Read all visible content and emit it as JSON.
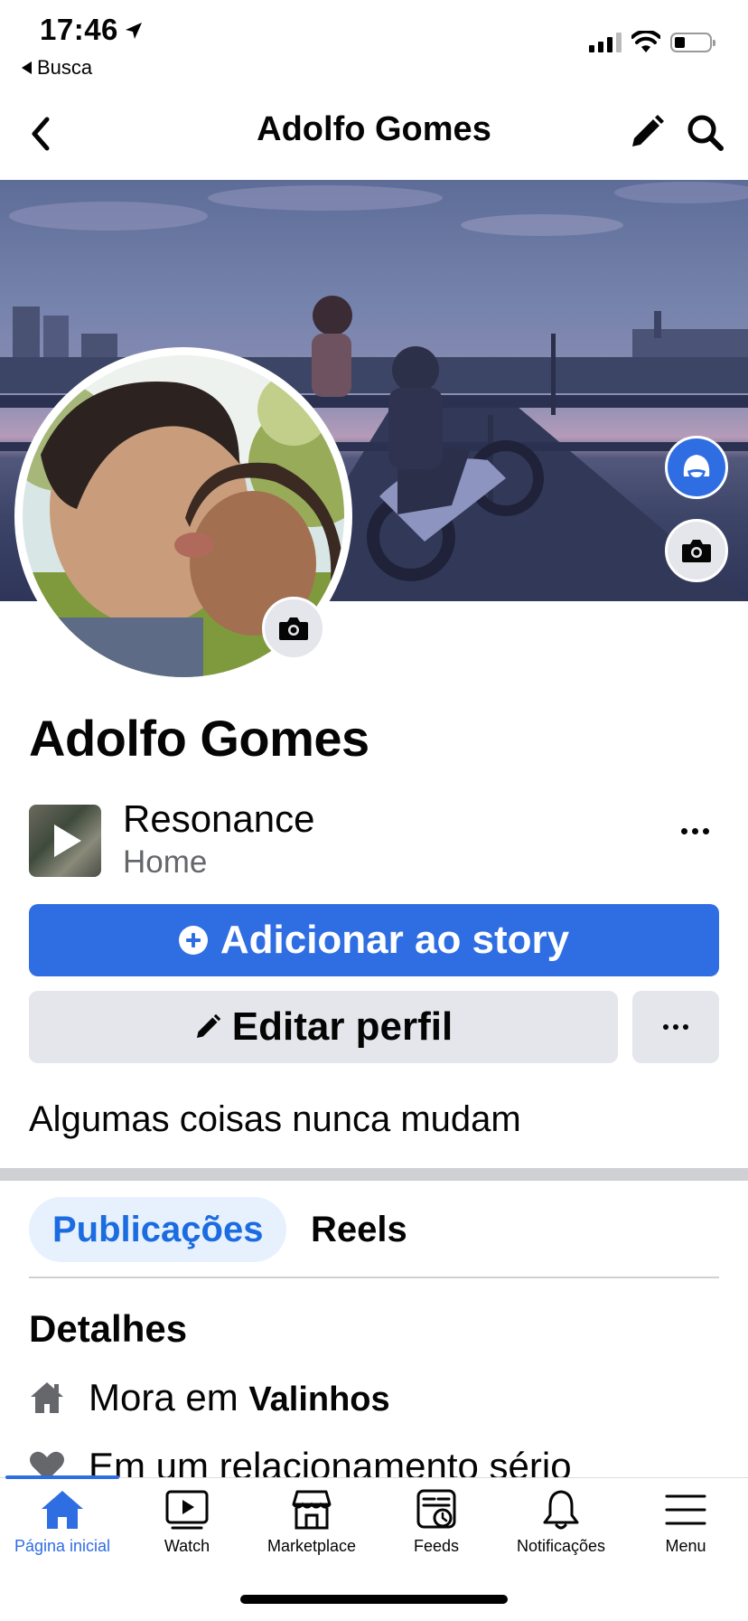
{
  "status_bar": {
    "time": "17:46",
    "back_app": "Busca",
    "location_icon": "location-arrow-icon",
    "signal_icon": "cellular-signal-icon",
    "wifi_icon": "wifi-icon",
    "battery_icon": "battery-icon"
  },
  "nav": {
    "title": "Adolfo Gomes",
    "back_icon": "chevron-left-icon",
    "edit_icon": "pencil-icon",
    "search_icon": "search-icon"
  },
  "profile": {
    "name": "Adolfo Gomes",
    "bio": "Algumas coisas nunca mudam"
  },
  "music": {
    "title": "Resonance",
    "subtitle": "Home"
  },
  "buttons": {
    "add_story": "Adicionar ao story",
    "edit_profile": "Editar perfil"
  },
  "tabs": {
    "posts": "Publicações",
    "reels": "Reels"
  },
  "details": {
    "title": "Detalhes",
    "lives_in_prefix": "Mora em",
    "lives_in_city": "Valinhos",
    "relationship": "Em um relacionamento sério"
  },
  "tabbar": {
    "items": [
      {
        "label": "Página inicial",
        "icon": "home-icon",
        "active": true
      },
      {
        "label": "Watch",
        "icon": "watch-icon",
        "active": false
      },
      {
        "label": "Marketplace",
        "icon": "marketplace-icon",
        "active": false
      },
      {
        "label": "Feeds",
        "icon": "feeds-icon",
        "active": false
      },
      {
        "label": "Notificações",
        "icon": "bell-icon",
        "active": false
      },
      {
        "label": "Menu",
        "icon": "menu-icon",
        "active": false
      }
    ]
  },
  "colors": {
    "accent": "#2f6ee2",
    "button_gray": "#e4e6eb",
    "secondary_text": "#65676b",
    "tab_active_bg": "#e7f0fd"
  }
}
